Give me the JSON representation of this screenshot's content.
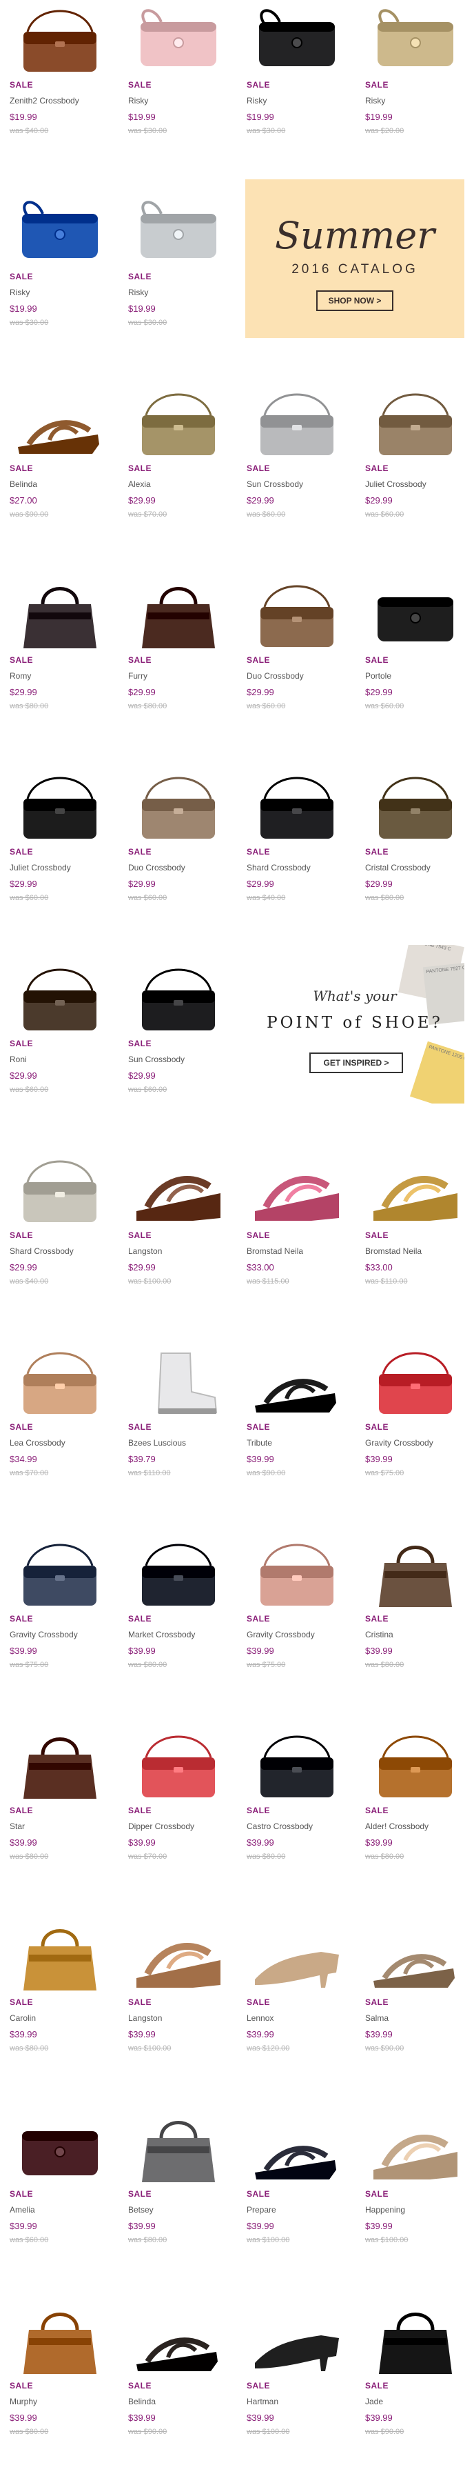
{
  "sale_label": "SALE",
  "products": [
    {
      "name": "Zenith2 Crossbody",
      "price": "$19.99",
      "was": "was $40.00",
      "icon": "handbag-icon",
      "color": "#8a4b2a"
    },
    {
      "name": "Risky",
      "price": "$19.99",
      "was": "was $30.00",
      "icon": "wristlet-icon",
      "color": "#f0c3c6"
    },
    {
      "name": "Risky",
      "price": "$19.99",
      "was": "was $30.00",
      "icon": "wristlet-icon",
      "color": "#232325"
    },
    {
      "name": "Risky",
      "price": "$19.99",
      "was": "was $20.00",
      "icon": "wristlet-icon",
      "color": "#cdb98c"
    },
    {
      "name": "Risky",
      "price": "$19.99",
      "was": "was $30.00",
      "icon": "wristlet-icon",
      "color": "#1f57b4"
    },
    {
      "name": "Risky",
      "price": "$19.99",
      "was": "was $30.00",
      "icon": "wristlet-icon",
      "color": "#c8cccf"
    },
    {
      "name": "Belinda",
      "price": "$27.00",
      "was": "was $90.00",
      "icon": "sandal-icon",
      "color": "#8f5a2e"
    },
    {
      "name": "Alexia",
      "price": "$29.99",
      "was": "was $70.00",
      "icon": "crossbody-icon",
      "color": "#a59468"
    },
    {
      "name": "Sun Crossbody",
      "price": "$29.99",
      "was": "was $60.00",
      "icon": "crossbody-icon",
      "color": "#b9babc"
    },
    {
      "name": "Juliet Crossbody",
      "price": "$29.99",
      "was": "was $60.00",
      "icon": "crossbody-icon",
      "color": "#9a8368"
    },
    {
      "name": "Romy",
      "price": "$29.99",
      "was": "was $80.00",
      "icon": "tote-icon",
      "color": "#3a3034"
    },
    {
      "name": "Furry",
      "price": "$29.99",
      "was": "was $80.00",
      "icon": "tote-icon",
      "color": "#4b2a20"
    },
    {
      "name": "Duo Crossbody",
      "price": "$29.99",
      "was": "was $60.00",
      "icon": "crossbody-icon",
      "color": "#8c6a4e"
    },
    {
      "name": "Portole",
      "price": "$29.99",
      "was": "was $60.00",
      "icon": "clutch-icon",
      "color": "#1e1e1e"
    },
    {
      "name": "Juliet Crossbody",
      "price": "$29.99",
      "was": "was $60.00",
      "icon": "crossbody-icon",
      "color": "#1c1c1c"
    },
    {
      "name": "Duo Crossbody",
      "price": "$29.99",
      "was": "was $60.00",
      "icon": "crossbody-icon",
      "color": "#9e8670"
    },
    {
      "name": "Shard Crossbody",
      "price": "$29.99",
      "was": "was $40.00",
      "icon": "crossbody-icon",
      "color": "#1f1f22"
    },
    {
      "name": "Cristal Crossbody",
      "price": "$29.99",
      "was": "was $80.00",
      "icon": "crossbody-icon",
      "color": "#6a5a40"
    },
    {
      "name": "Roni",
      "price": "$29.99",
      "was": "was $60.00",
      "icon": "crossbody-icon",
      "color": "#4b3a2c"
    },
    {
      "name": "Sun Crossbody",
      "price": "$29.99",
      "was": "was $60.00",
      "icon": "crossbody-icon",
      "color": "#1d1d1f"
    },
    {
      "name": "Shard Crossbody",
      "price": "$29.99",
      "was": "was $40.00",
      "icon": "crossbody-icon",
      "color": "#c9c6bb"
    },
    {
      "name": "Langston",
      "price": "$29.99",
      "was": "was $100.00",
      "icon": "wedge-sandal-icon",
      "color": "#6b3b26"
    },
    {
      "name": "Bromstad Neila",
      "price": "$33.00",
      "was": "was $115.00",
      "icon": "wedge-sandal-icon",
      "color": "#c8577a"
    },
    {
      "name": "Bromstad Neila",
      "price": "$33.00",
      "was": "was $110.00",
      "icon": "wedge-sandal-icon",
      "color": "#c49a42"
    },
    {
      "name": "Lea Crossbody",
      "price": "$34.99",
      "was": "was $70.00",
      "icon": "crossbody-icon",
      "color": "#d7a783"
    },
    {
      "name": "Bzees Luscious",
      "price": "$39.79",
      "was": "was $110.00",
      "icon": "boot-icon",
      "color": "#e8e8ea"
    },
    {
      "name": "Tribute",
      "price": "$39.99",
      "was": "was $90.00",
      "icon": "sandal-icon",
      "color": "#1b1b1b"
    },
    {
      "name": "Gravity Crossbody",
      "price": "$39.99",
      "was": "was $75.00",
      "icon": "crossbody-icon",
      "color": "#e0454d"
    },
    {
      "name": "Gravity Crossbody",
      "price": "$39.99",
      "was": "was $75.00",
      "icon": "crossbody-icon",
      "color": "#3e4a62"
    },
    {
      "name": "Market Crossbody",
      "price": "$39.99",
      "was": "was $80.00",
      "icon": "crossbody-icon",
      "color": "#1f2430"
    },
    {
      "name": "Gravity Crossbody",
      "price": "$39.99",
      "was": "was $75.00",
      "icon": "crossbody-icon",
      "color": "#d9a295"
    },
    {
      "name": "Cristina",
      "price": "$39.99",
      "was": "was $80.00",
      "icon": "tote-icon",
      "color": "#6b5240"
    },
    {
      "name": "Star",
      "price": "$39.99",
      "was": "was $80.00",
      "icon": "tote-icon",
      "color": "#5a2f22"
    },
    {
      "name": "Dipper Crossbody",
      "price": "$39.99",
      "was": "was $70.00",
      "icon": "crossbody-icon",
      "color": "#e2545a"
    },
    {
      "name": "Castro Crossbody",
      "price": "$39.99",
      "was": "was $80.00",
      "icon": "crossbody-icon",
      "color": "#22252c"
    },
    {
      "name": "Alder! Crossbody",
      "price": "$39.99",
      "was": "was $80.00",
      "icon": "crossbody-icon",
      "color": "#b5712d"
    },
    {
      "name": "Carolin",
      "price": "$39.99",
      "was": "was $80.00",
      "icon": "tote-icon",
      "color": "#c99239"
    },
    {
      "name": "Langston",
      "price": "$39.99",
      "was": "was $100.00",
      "icon": "wedge-sandal-icon",
      "color": "#b6835c"
    },
    {
      "name": "Lennox",
      "price": "$39.99",
      "was": "was $120.00",
      "icon": "pump-icon",
      "color": "#c9a987"
    },
    {
      "name": "Salma",
      "price": "$39.99",
      "was": "was $90.00",
      "icon": "sandal-icon",
      "color": "#a48a70"
    },
    {
      "name": "Amelia",
      "price": "$39.99",
      "was": "was $60.00",
      "icon": "wallet-icon",
      "color": "#4a1f25"
    },
    {
      "name": "Betsey",
      "price": "$39.99",
      "was": "was $80.00",
      "icon": "tote-icon",
      "color": "#6d6d6f"
    },
    {
      "name": "Prepare",
      "price": "$39.99",
      "was": "was $100.00",
      "icon": "sandal-icon",
      "color": "#2a2c3a"
    },
    {
      "name": "Happening",
      "price": "$39.99",
      "was": "was $100.00",
      "icon": "wedge-sandal-icon",
      "color": "#c4a88a"
    },
    {
      "name": "Murphy",
      "price": "$39.99",
      "was": "was $80.00",
      "icon": "tote-icon",
      "color": "#b06a2c"
    },
    {
      "name": "Belinda",
      "price": "$39.99",
      "was": "was $90.00",
      "icon": "sandal-icon",
      "color": "#2a2320"
    },
    {
      "name": "Hartman",
      "price": "$39.99",
      "was": "was $100.00",
      "icon": "pump-icon",
      "color": "#1f1f1f"
    },
    {
      "name": "Jade",
      "price": "$39.99",
      "was": "was $90.00",
      "icon": "tote-icon",
      "color": "#151515"
    }
  ],
  "summer_banner": {
    "title": "Summer",
    "subtitle": "2016 CATALOG",
    "cta": "SHOP NOW >",
    "bg": "#fce2b4"
  },
  "shoe_banner": {
    "line1": "What's your",
    "line2": "POINT of SHOE?",
    "cta": "GET INSPIRED >",
    "swatch_labels": [
      "PANTONE 7543 C",
      "PANTONE 7527 C",
      "PANTONE 1205 C"
    ]
  },
  "colors": {
    "sale": "#8a1f78",
    "was": "#b4b4b4",
    "name": "#555555"
  }
}
